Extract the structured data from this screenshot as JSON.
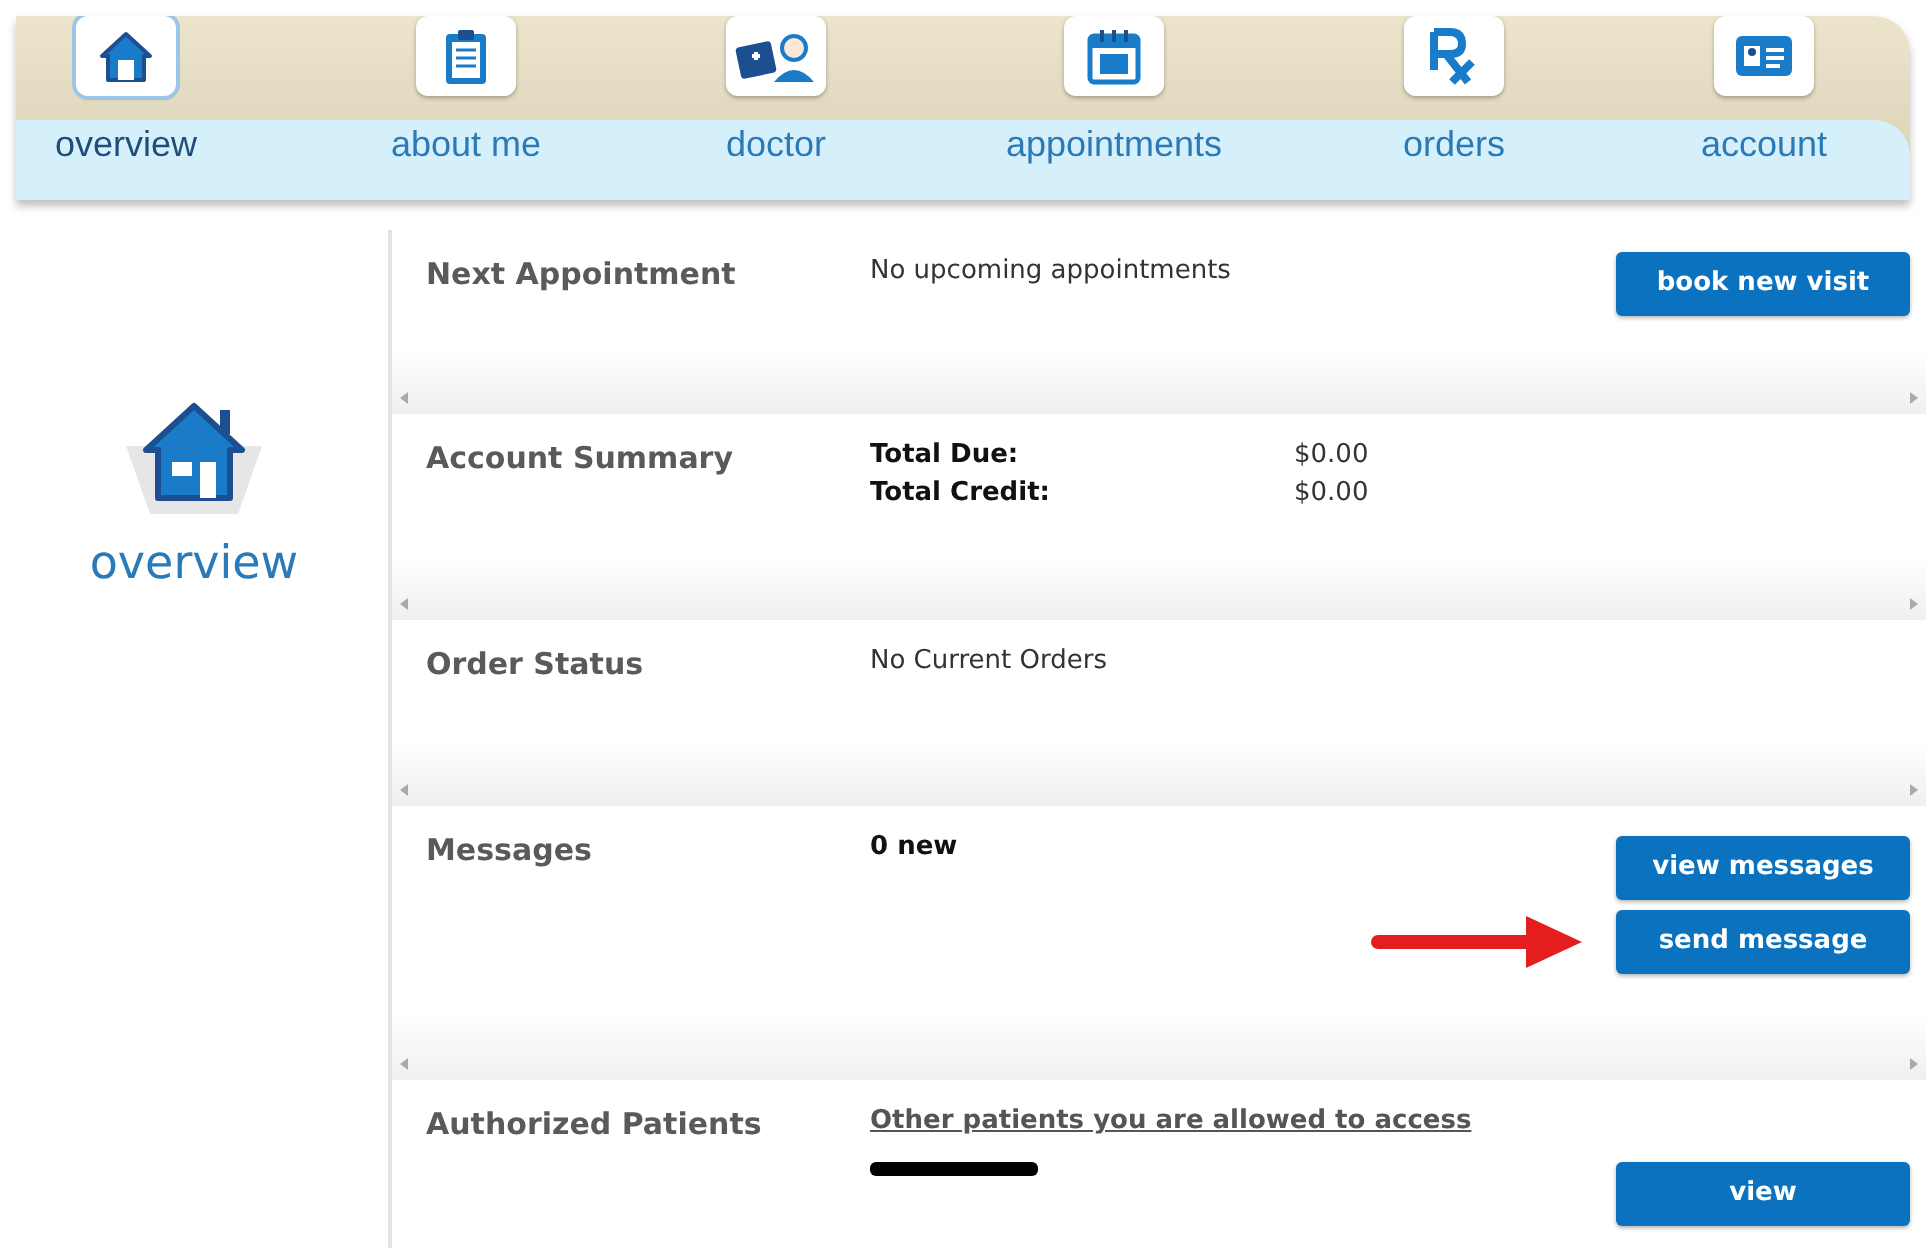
{
  "nav": {
    "tabs": [
      {
        "label": "overview",
        "selected": true
      },
      {
        "label": "about me",
        "selected": false
      },
      {
        "label": "doctor",
        "selected": false
      },
      {
        "label": "appointments",
        "selected": false
      },
      {
        "label": "orders",
        "selected": false
      },
      {
        "label": "account",
        "selected": false
      }
    ]
  },
  "page_heading": "overview",
  "sections": [
    {
      "kind": "text",
      "title": "Next Appointment",
      "text": "No upcoming appointments",
      "buttons": [
        {
          "label": "book new visit",
          "pointed": false
        }
      ]
    },
    {
      "kind": "totals",
      "title": "Account Summary",
      "totals": [
        {
          "label": "Total Due:",
          "amount": "$0.00"
        },
        {
          "label": "Total Credit:",
          "amount": "$0.00"
        }
      ]
    },
    {
      "kind": "text",
      "title": "Order Status",
      "text": "No Current Orders"
    },
    {
      "kind": "count",
      "title": "Messages",
      "text": "0 new",
      "buttons": [
        {
          "label": "view messages",
          "pointed": false
        },
        {
          "label": "send message",
          "pointed": true
        }
      ]
    },
    {
      "kind": "patients",
      "title": "Authorized Patients",
      "link": "Other patients you are allowed to access",
      "redacted": true,
      "buttons": [
        {
          "label": "view",
          "pointed": false
        }
      ]
    }
  ]
}
